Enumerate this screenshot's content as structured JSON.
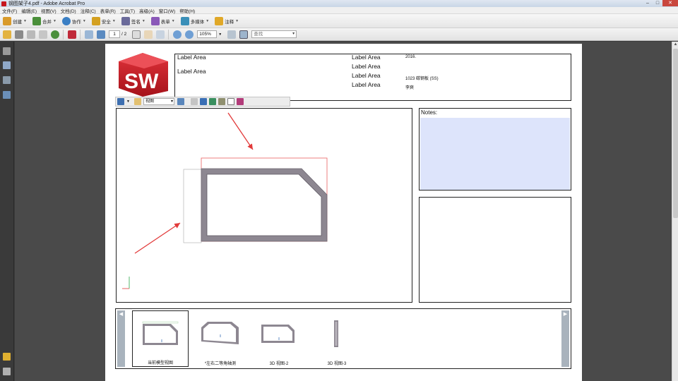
{
  "window": {
    "title": "钢图架子4.pdf - Adobe Acrobat Pro",
    "buttons": {
      "minimize": "–",
      "maximize": "□",
      "close": "✕"
    }
  },
  "menu": [
    "文件(F)",
    "编辑(E)",
    "视图(V)",
    "文档(D)",
    "注释(C)",
    "表单(R)",
    "工具(T)",
    "高级(A)",
    "窗口(W)",
    "帮助(H)"
  ],
  "toolbar1": [
    {
      "label": "创建",
      "icon": "create-icon",
      "color": "#d99a2a"
    },
    {
      "label": "合并",
      "icon": "combine-icon",
      "color": "#4a8f3a"
    },
    {
      "label": "协作",
      "icon": "collaborate-icon",
      "color": "#3a7fc4"
    },
    {
      "label": "安全",
      "icon": "lock-icon",
      "color": "#d4a020"
    },
    {
      "label": "签名",
      "icon": "pen-icon",
      "color": "#6a6a9a"
    },
    {
      "label": "表单",
      "icon": "form-icon",
      "color": "#8a58b8"
    },
    {
      "label": "多媒体",
      "icon": "multimedia-icon",
      "color": "#3a8fb8"
    },
    {
      "label": "注释",
      "icon": "comment-icon",
      "color": "#e0a828"
    }
  ],
  "toolbar2": {
    "page_current": "1",
    "page_total": "/ 2",
    "zoom": "105%",
    "find_placeholder": "查找"
  },
  "title_block": {
    "label_area_1": "Label Area",
    "label_area_2": "Label Area",
    "label_area_3": "Label Area",
    "label_area_4": "Label Area",
    "label_area_5": "Label Area",
    "label_area_6": "Label Area",
    "value_1": "2016.",
    "value_3": "1023 碳钢板 (SS)",
    "value_4": "李爽"
  },
  "logo": {
    "text": "SW",
    "color": "#c8202a"
  },
  "mini_toolbar": {
    "view_select": "视图"
  },
  "notes": {
    "label": "Notes:"
  },
  "thumbnails": [
    {
      "label": "当前模型视图",
      "selected": true
    },
    {
      "label": "*左右二等角轴测",
      "selected": false
    },
    {
      "label": "3D 视图-2",
      "selected": false
    },
    {
      "label": "3D 视图-3",
      "selected": false
    }
  ],
  "colors": {
    "annotation_arrow": "#e23a3a",
    "frame_fill": "#8d8791",
    "notes_fill": "#dde4fb"
  }
}
